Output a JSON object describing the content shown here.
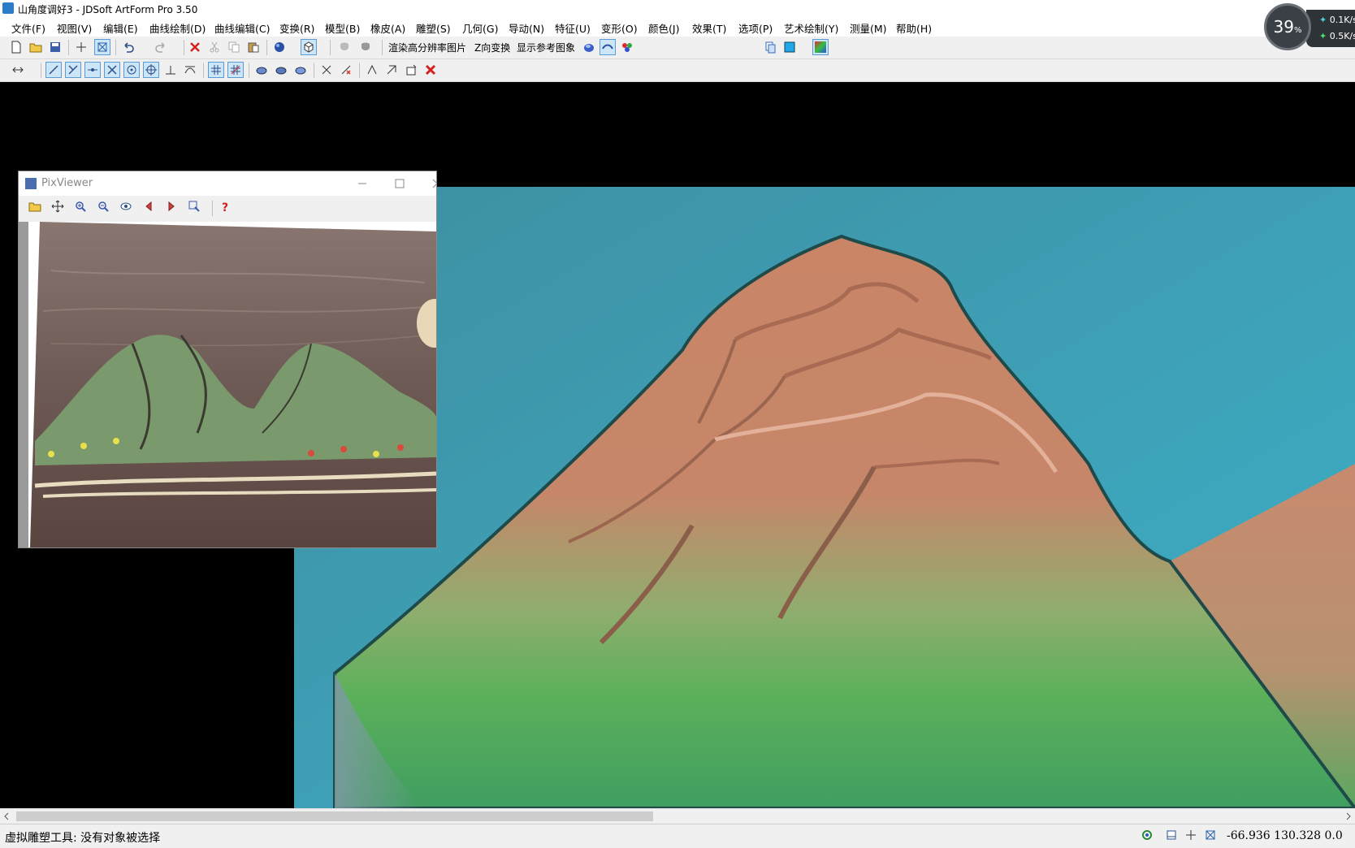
{
  "window": {
    "title": "山角度调好3 - JDSoft ArtForm Pro 3.50"
  },
  "menu": [
    "文件(F)",
    "视图(V)",
    "编辑(E)",
    "曲线绘制(D)",
    "曲线编辑(C)",
    "变换(R)",
    "模型(B)",
    "橡皮(A)",
    "雕塑(S)",
    "几何(G)",
    "导动(N)",
    "特征(U)",
    "变形(O)",
    "颜色(J)",
    "效果(T)",
    "选项(P)",
    "艺术绘制(Y)",
    "测量(M)",
    "帮助(H)"
  ],
  "toolbar1": {
    "render_hires": "渲染高分辨率图片",
    "z_transform": "Z向变换",
    "show_reference": "显示参考图象"
  },
  "pixviewer": {
    "title": "PixViewer"
  },
  "status": {
    "message": "虚拟雕塑工具: 没有对象被选择",
    "coords": "-66.936  130.328  0.0"
  },
  "net_widget": {
    "percent": "39",
    "percent_unit": "%",
    "up": "0.1",
    "down": "0.5",
    "unit": "K/s"
  },
  "colors": {
    "accent": "#2a7dc8",
    "sky": "#3a9db0",
    "mountain": "#c88666",
    "grass": "#5cae5a"
  },
  "icons": {
    "toolbar1": [
      "new-file-icon",
      "open-folder-icon",
      "save-icon",
      "crosshair-icon",
      "select-box-icon",
      "undo-icon",
      "redo-icon",
      "delete-icon",
      "cut-icon",
      "copy-icon",
      "paste-icon",
      "sphere-icon",
      "view-cube-icon",
      "mask-icon",
      "mask-filled-icon",
      "render-icon",
      "surface-icon",
      "palette-icon",
      "layers-icon",
      "color-swatch-icon",
      "gradient-icon"
    ],
    "toolbar2": [
      "snap-icon",
      "line-icon",
      "trim-icon",
      "point-icon",
      "cross-icon",
      "circle-point-icon",
      "circle-cross-icon",
      "perpendicular-icon",
      "tangent-icon",
      "grid-icon",
      "grid-snap-icon",
      "emboss-a-icon",
      "emboss-b-icon",
      "emboss-c-icon",
      "scissor-a-icon",
      "scissor-b-icon",
      "tool-a-icon",
      "tool-b-icon",
      "tool-c-icon",
      "close-x-icon"
    ],
    "pixviewer": [
      "open-folder-icon",
      "move-icon",
      "zoom-in-icon",
      "zoom-out-icon",
      "eye-icon",
      "prev-icon",
      "next-icon",
      "zoom-fit-icon",
      "help-icon"
    ]
  }
}
